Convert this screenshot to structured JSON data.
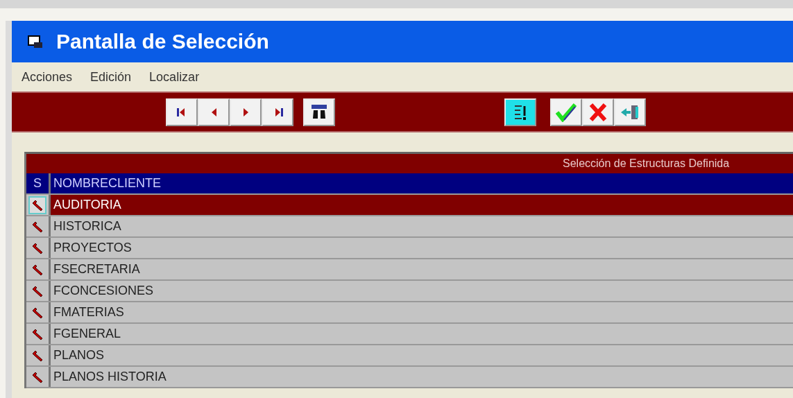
{
  "window": {
    "title": "Pantalla de Selección"
  },
  "menu": [
    "Acciones",
    "Edición",
    "Localizar"
  ],
  "grid": {
    "caption": "Selección de Estructuras Definida",
    "columns": [
      "S",
      "NOMBRECLIENTE"
    ],
    "rows": [
      {
        "name": "AUDITORIA",
        "selected": true
      },
      {
        "name": "HISTORICA",
        "selected": false
      },
      {
        "name": "PROYECTOS",
        "selected": false
      },
      {
        "name": "FSECRETARIA",
        "selected": false
      },
      {
        "name": "FCONCESIONES",
        "selected": false
      },
      {
        "name": "FMATERIAS",
        "selected": false
      },
      {
        "name": "FGENERAL",
        "selected": false
      },
      {
        "name": "PLANOS",
        "selected": false
      },
      {
        "name": "PLANOS HISTORIA",
        "selected": false
      }
    ]
  }
}
